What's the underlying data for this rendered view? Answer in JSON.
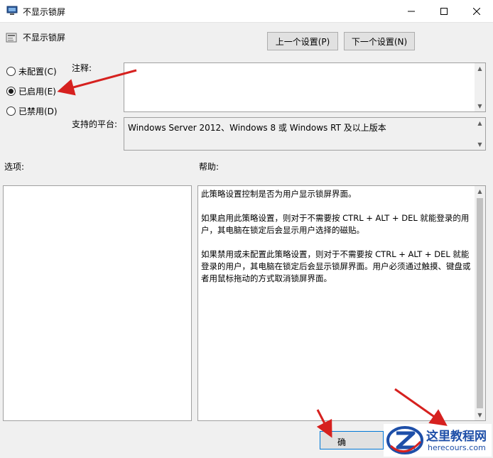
{
  "window": {
    "title": "不显示锁屏"
  },
  "header": {
    "title": "不显示锁屏",
    "prev_label": "上一个设置(P)",
    "next_label": "下一个设置(N)"
  },
  "state": {
    "options": [
      {
        "label": "未配置(C)",
        "checked": false
      },
      {
        "label": "已启用(E)",
        "checked": true
      },
      {
        "label": "已禁用(D)",
        "checked": false
      }
    ]
  },
  "comment": {
    "label": "注释:",
    "value": ""
  },
  "platform": {
    "label": "支持的平台:",
    "value": "Windows Server 2012、Windows 8 或 Windows RT 及以上版本"
  },
  "options_section": {
    "label": "选项:"
  },
  "help_section": {
    "label": "帮助:",
    "text": "此策略设置控制是否为用户显示锁屏界面。\n\n如果启用此策略设置，则对于不需要按 CTRL + ALT + DEL 就能登录的用户，其电脑在锁定后会显示用户选择的磁贴。\n\n如果禁用或未配置此策略设置，则对于不需要按 CTRL + ALT + DEL 就能登录的用户，其电脑在锁定后会显示锁屏界面。用户必须通过触摸、键盘或者用鼠标拖动的方式取消锁屏界面。"
  },
  "footer": {
    "ok_label": "确"
  },
  "watermark": {
    "cn": "这里教程网",
    "en": "herecours.com"
  },
  "colors": {
    "annotation_red": "#d6211f",
    "ok_border": "#0078d7",
    "brand_blue": "#1e4fa8"
  }
}
